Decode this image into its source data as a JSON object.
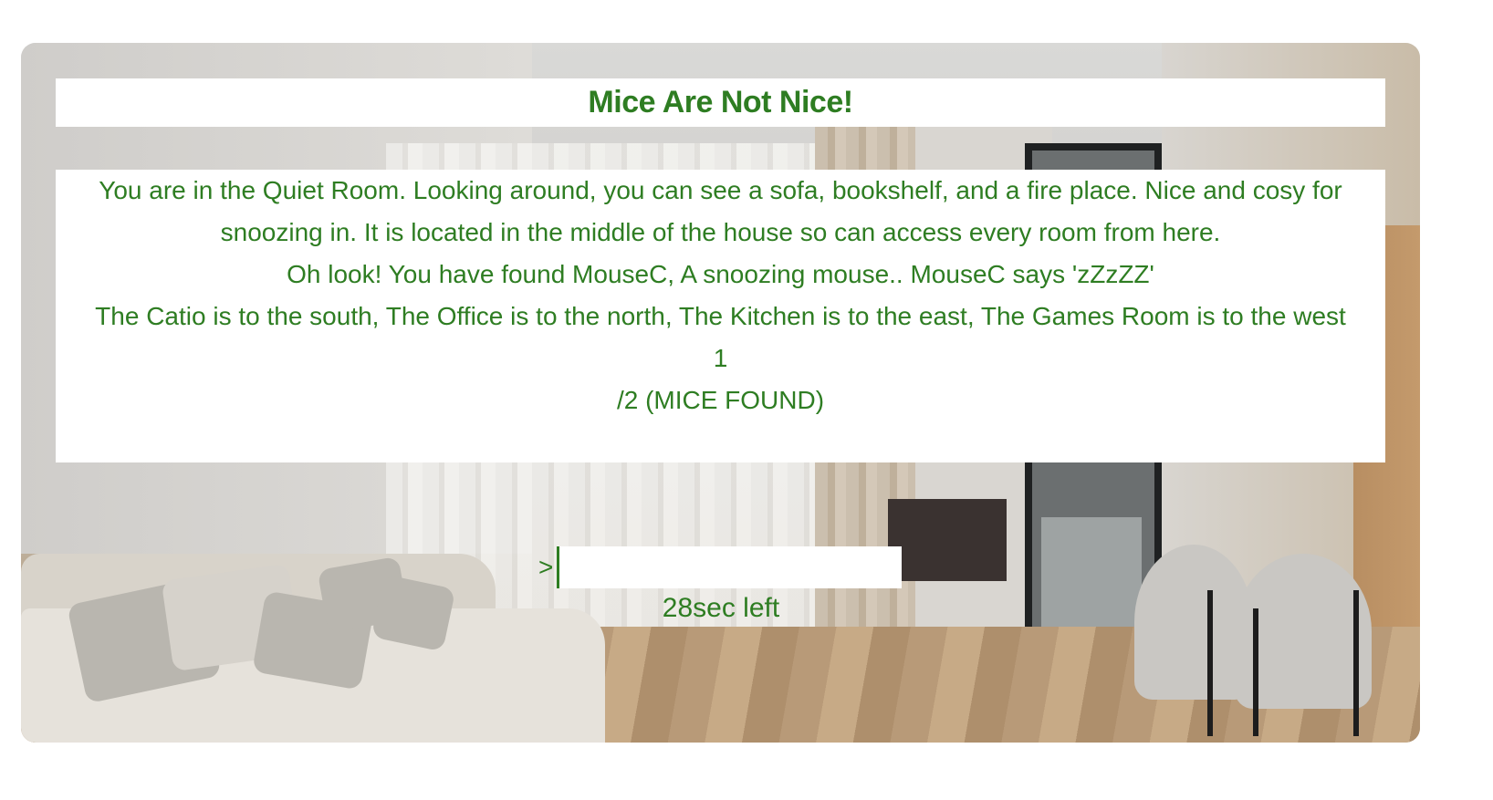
{
  "game": {
    "title": "Mice Are Not Nice!",
    "description": "You are in the Quiet Room. Looking around, you can see a sofa, bookshelf, and a fire place. Nice and cosy for snoozing in. It is located in the middle of the house so can access every room from here.",
    "event": "Oh look! You have found MouseC, A snoozing mouse.. MouseC says 'zZzZZ'",
    "directions": "The Catio is to the south, The Office is to the north, The Kitchen is to the east, The Games Room is to the west",
    "mice_found_count": "1",
    "mice_found_total": "/2 (MICE FOUND)",
    "prompt_symbol": ">",
    "command_value": "",
    "timer_text": "28sec left"
  },
  "colors": {
    "text": "#2e7d22",
    "panel": "#ffffff"
  }
}
